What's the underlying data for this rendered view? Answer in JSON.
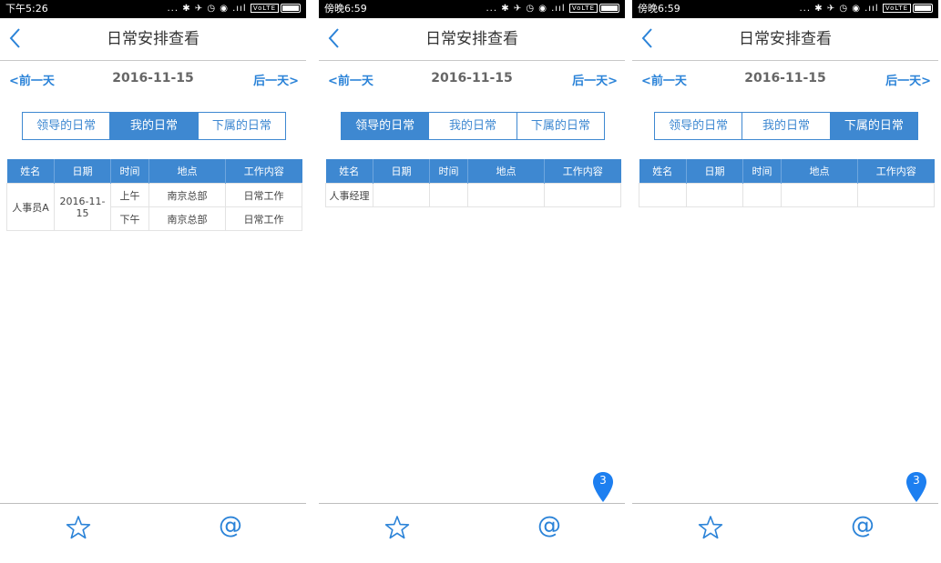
{
  "screens": [
    {
      "status_time": "下午5:26",
      "status_icons": "... ✱ ✈ ◷ ◉ .ııl",
      "volte": "VoLTE",
      "title": "日常安排查看",
      "prev_day": "<前一天",
      "date": "2016-11-15",
      "next_day": "后一天>",
      "segments": [
        "领导的日常",
        "我的日常",
        "下属的日常"
      ],
      "active_segment": 1,
      "headers": [
        "姓名",
        "日期",
        "时间",
        "地点",
        "工作内容"
      ],
      "rows": [
        {
          "name": "人事员A",
          "date": "2016-11-15",
          "entries": [
            {
              "time": "上午",
              "place": "南京总部",
              "work": "日常工作"
            },
            {
              "time": "下午",
              "place": "南京总部",
              "work": "日常工作"
            }
          ]
        }
      ],
      "badge": null
    },
    {
      "status_time": "傍晚6:59",
      "status_icons": "... ✱ ✈ ◷ ◉ .ııl",
      "volte": "VoLTE",
      "title": "日常安排查看",
      "prev_day": "<前一天",
      "date": "2016-11-15",
      "next_day": "后一天>",
      "segments": [
        "领导的日常",
        "我的日常",
        "下属的日常"
      ],
      "active_segment": 0,
      "headers": [
        "姓名",
        "日期",
        "时间",
        "地点",
        "工作内容"
      ],
      "rows": [
        {
          "name": "人事经理",
          "date": "",
          "entries": [
            {
              "time": "",
              "place": "",
              "work": ""
            }
          ]
        }
      ],
      "badge": "3"
    },
    {
      "status_time": "傍晚6:59",
      "status_icons": "... ✱ ✈ ◷ ◉ .ııl",
      "volte": "VoLTE",
      "title": "日常安排查看",
      "prev_day": "<前一天",
      "date": "2016-11-15",
      "next_day": "后一天>",
      "segments": [
        "领导的日常",
        "我的日常",
        "下属的日常"
      ],
      "active_segment": 2,
      "headers": [
        "姓名",
        "日期",
        "时间",
        "地点",
        "工作内容"
      ],
      "rows": [
        {
          "name": "",
          "date": "",
          "entries": [
            {
              "time": "",
              "place": "",
              "work": ""
            }
          ]
        }
      ],
      "badge": "3"
    }
  ],
  "bottom": {
    "favorite_icon": "star-icon",
    "at_symbol": "@"
  },
  "colors": {
    "accent": "#3e88d1",
    "link": "#2b83d8",
    "badge": "#1d7ff0"
  }
}
